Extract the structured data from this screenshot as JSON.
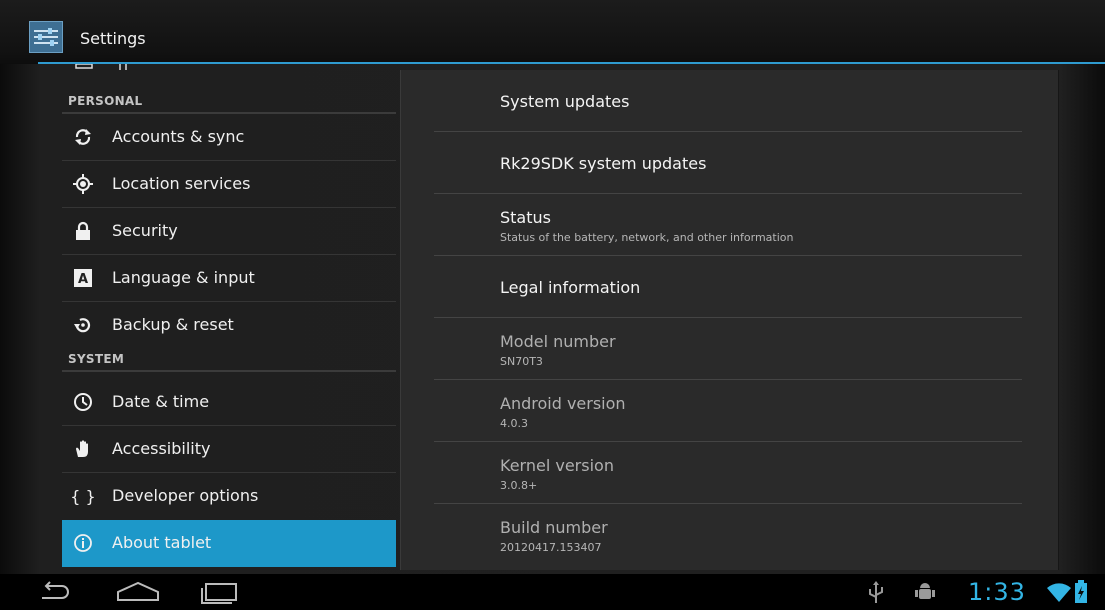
{
  "app": {
    "title": "Settings"
  },
  "left_list": {
    "personal_header": "PERSONAL",
    "system_header": "SYSTEM",
    "items": [
      {
        "label": "Accounts & sync",
        "icon": "sync-icon"
      },
      {
        "label": "Location services",
        "icon": "location-icon"
      },
      {
        "label": "Security",
        "icon": "lock-icon"
      },
      {
        "label": "Language & input",
        "icon": "language-icon"
      },
      {
        "label": "Backup & reset",
        "icon": "backup-icon"
      },
      {
        "label": "Date & time",
        "icon": "clock-icon"
      },
      {
        "label": "Accessibility",
        "icon": "hand-icon"
      },
      {
        "label": "Developer options",
        "icon": "braces-icon",
        "glyph": "{ }"
      },
      {
        "label": "About tablet",
        "icon": "info-icon",
        "selected": true
      }
    ]
  },
  "about": {
    "rows": [
      {
        "title": "System updates"
      },
      {
        "title": "Rk29SDK system updates"
      },
      {
        "title": "Status",
        "summary": "Status of the battery, network, and other information"
      },
      {
        "title": "Legal information"
      },
      {
        "title": "Model number",
        "summary": "SN70T3"
      },
      {
        "title": "Android version",
        "summary": "4.0.3"
      },
      {
        "title": "Kernel version",
        "summary": "3.0.8+"
      },
      {
        "title": "Build number",
        "summary": "20120417.153407"
      }
    ]
  },
  "status_bar": {
    "time": "1:33"
  },
  "colors": {
    "accent": "#33b5e5",
    "selected": "#1d98c9",
    "rule": "#2f9bd0"
  }
}
